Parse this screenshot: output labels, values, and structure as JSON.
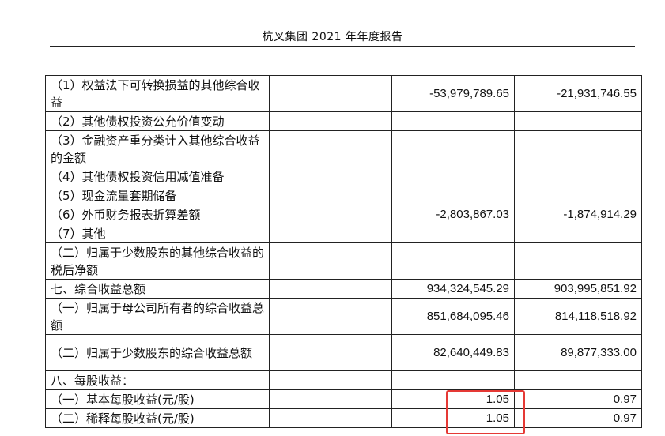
{
  "header": {
    "title": "杭叉集团 2021 年年度报告"
  },
  "rows": [
    {
      "label": "（1）权益法下可转换损益的其他综合收益",
      "col2": "-53,979,789.65",
      "col3": "-21,931,746.55"
    },
    {
      "label": "（2）其他债权投资公允价值变动",
      "col2": "",
      "col3": ""
    },
    {
      "label": "（3）金融资产重分类计入其他综合收益的金额",
      "col2": "",
      "col3": ""
    },
    {
      "label": "（4）其他债权投资信用减值准备",
      "col2": "",
      "col3": ""
    },
    {
      "label": "（5）现金流量套期储备",
      "col2": "",
      "col3": ""
    },
    {
      "label": "（6）外币财务报表折算差额",
      "col2": "-2,803,867.03",
      "col3": "-1,874,914.29"
    },
    {
      "label": "（7）其他",
      "col2": "",
      "col3": ""
    },
    {
      "label": "（二）归属于少数股东的其他综合收益的税后净额",
      "col2": "",
      "col3": ""
    },
    {
      "label": "七、综合收益总额",
      "col2": "934,324,545.29",
      "col3": "903,995,851.92"
    },
    {
      "label": "（一）归属于母公司所有者的综合收益总额",
      "col2": "851,684,095.46",
      "col3": "814,118,518.92"
    },
    {
      "label": "（二）归属于少数股东的综合收益总额",
      "col2": "82,640,449.83",
      "col3": "89,877,333.00"
    },
    {
      "label": "八、每股收益：",
      "col2": "",
      "col3": ""
    },
    {
      "label": "（一）基本每股收益(元/股)",
      "col2": "1.05",
      "col3": "0.97"
    },
    {
      "label": "（二）稀释每股收益(元/股)",
      "col2": "1.05",
      "col3": "0.97"
    }
  ],
  "highlight": {
    "color": "#e53935"
  }
}
